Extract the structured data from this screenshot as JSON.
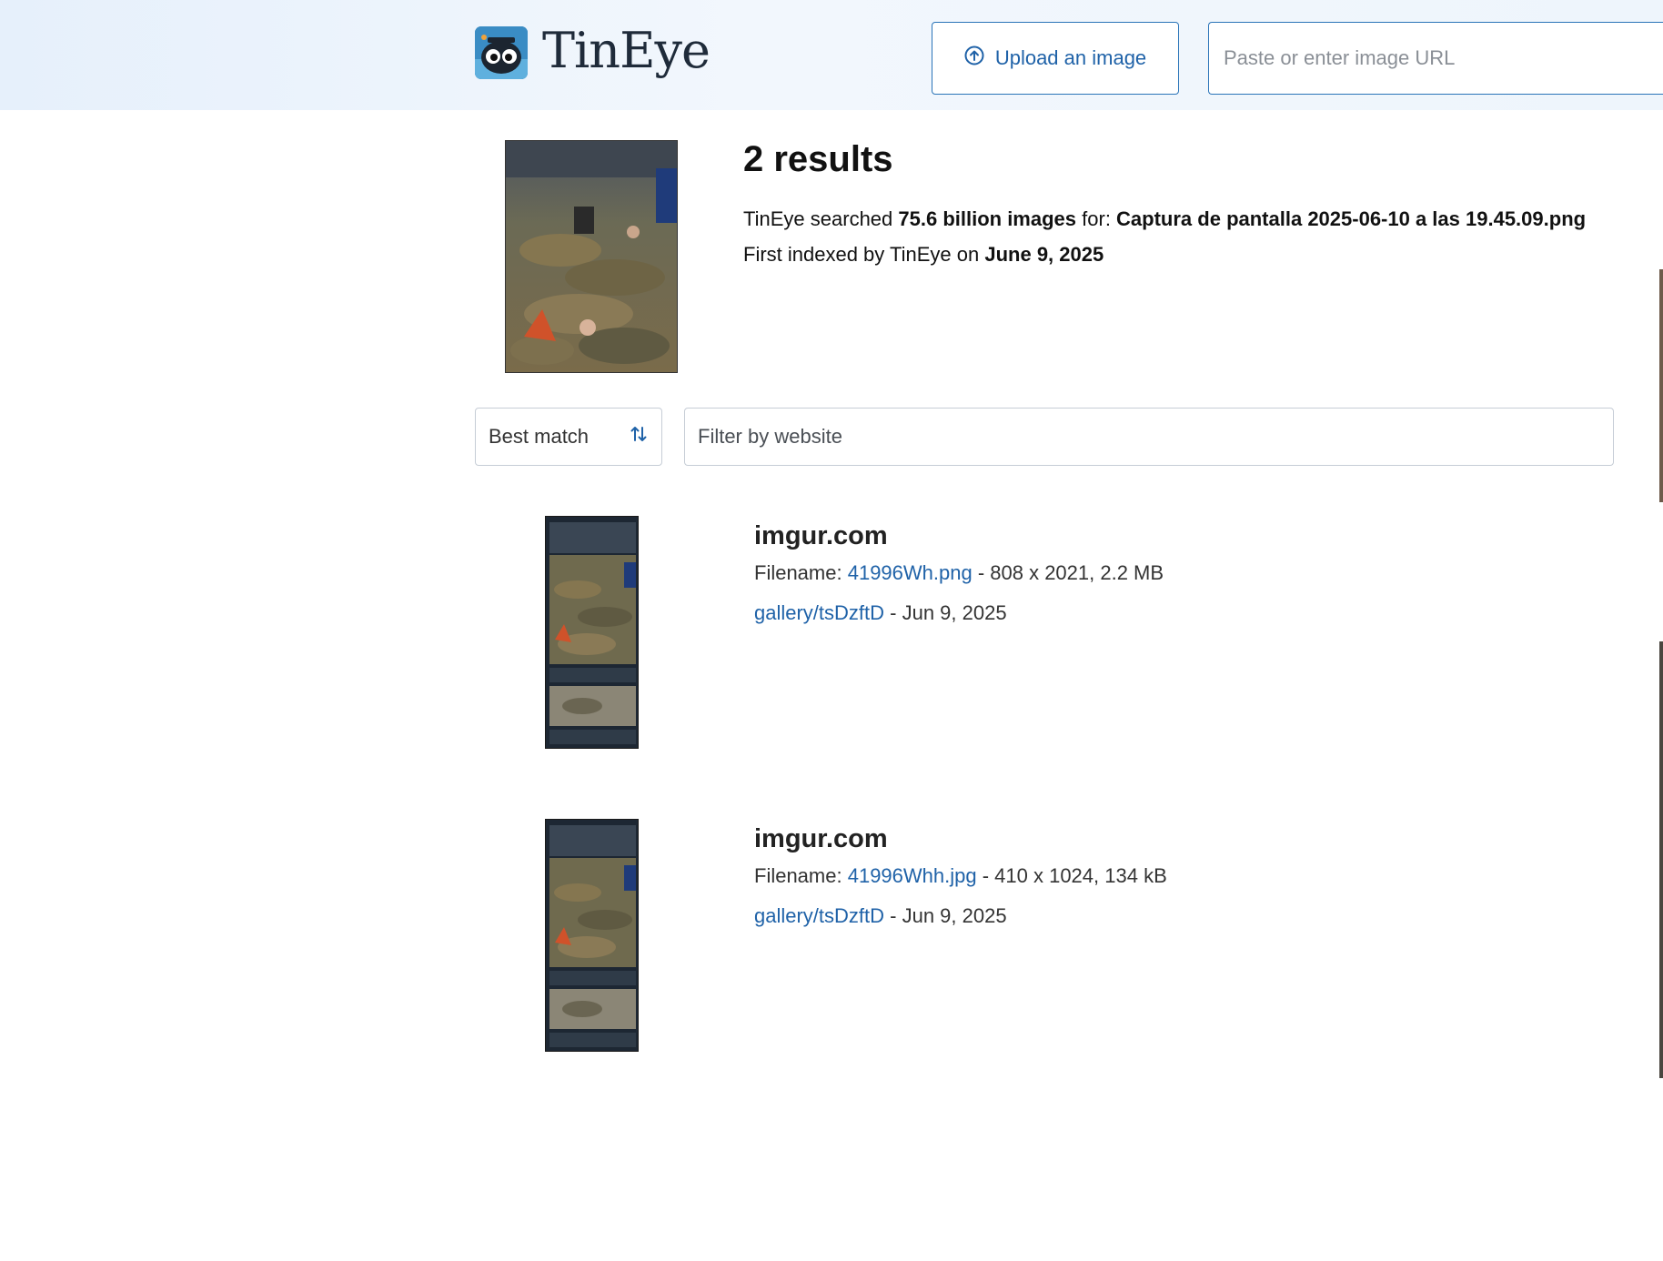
{
  "header": {
    "logo_text": "TinEye",
    "upload_label": "Upload an image",
    "url_placeholder": "Paste or enter image URL"
  },
  "query": {
    "results_count": "2 results",
    "searched_prefix": "TinEye searched ",
    "searched_count": "75.6 billion images",
    "searched_for": " for: ",
    "filename": "Captura de pantalla 2025-06-10 a las 19.45.09.png",
    "indexed_prefix": "First indexed by TinEye on ",
    "indexed_date": "June 9, 2025"
  },
  "controls": {
    "sort_label": "Best match",
    "filter_placeholder": "Filter by website"
  },
  "results": [
    {
      "site": "imgur.com",
      "filename_label": "Filename: ",
      "filename": "41996Wh.png",
      "meta": " - 808 x 2021, 2.2 MB",
      "gallery": "gallery/tsDzftD",
      "date": " - Jun 9, 2025"
    },
    {
      "site": "imgur.com",
      "filename_label": "Filename: ",
      "filename": "41996Whh.jpg",
      "meta": " - 410 x 1024, 134 kB",
      "gallery": "gallery/tsDzftD",
      "date": " - Jun 9, 2025"
    }
  ],
  "colors": {
    "accent": "#1f62a8",
    "header_bg": "#e6f0fb"
  }
}
